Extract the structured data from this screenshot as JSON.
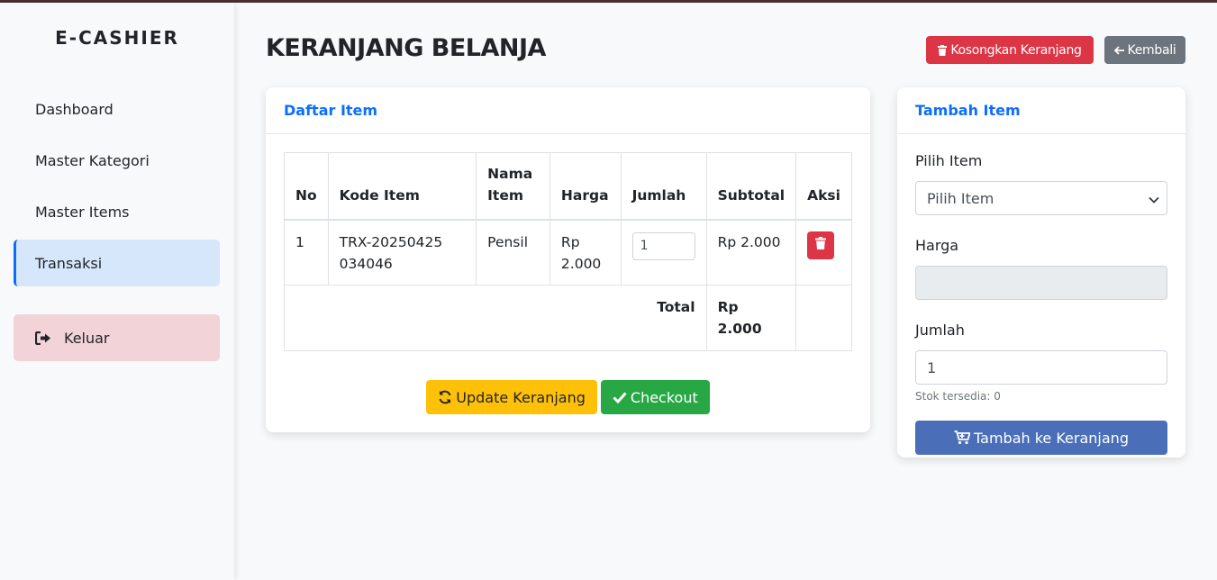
{
  "app": {
    "brand": "E-CASHIER"
  },
  "sidebar": {
    "items": [
      {
        "label": "Dashboard"
      },
      {
        "label": "Master Kategori"
      },
      {
        "label": "Master Items"
      },
      {
        "label": "Transaksi"
      }
    ],
    "logout_label": "Keluar"
  },
  "header": {
    "title": "KERANJANG BELANJA",
    "empty_cart_label": "Kosongkan Keranjang",
    "back_label": "Kembali"
  },
  "cart": {
    "card_title": "Daftar Item",
    "columns": [
      "No",
      "Kode Item",
      "Nama Item",
      "Harga",
      "Jumlah",
      "Subtotal",
      "Aksi"
    ],
    "rows": [
      {
        "no": "1",
        "kode": "TRX-20250425034046",
        "nama": "Pensil",
        "harga": "Rp 2.000",
        "jumlah": "1",
        "subtotal": "Rp 2.000"
      }
    ],
    "total_label": "Total",
    "total_value": "Rp 2.000",
    "update_label": "Update Keranjang",
    "checkout_label": "Checkout"
  },
  "add_form": {
    "card_title": "Tambah Item",
    "item_label": "Pilih Item",
    "item_selected": "Pilih Item",
    "price_label": "Harga",
    "price_value": "",
    "qty_label": "Jumlah",
    "qty_value": "1",
    "stock_hint": "Stok tersedia: 0",
    "submit_label": "Tambah ke Keranjang"
  },
  "colors": {
    "primary": "#0d6efd",
    "danger": "#dc3545",
    "secondary": "#6c757d",
    "warning": "#ffc107",
    "success": "#28a745",
    "add_button": "#4a6fb8"
  }
}
